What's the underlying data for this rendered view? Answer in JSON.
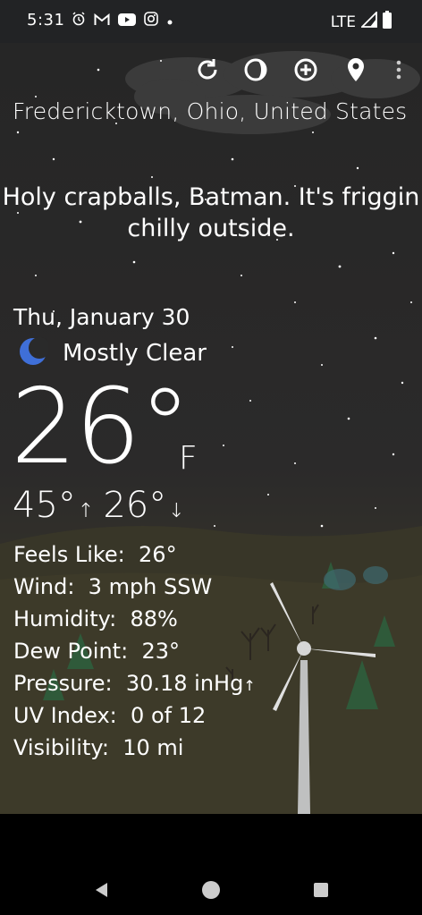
{
  "status": {
    "time": "5:31",
    "network": "LTE",
    "icons": [
      "alarm-icon",
      "gmail-icon",
      "youtube-icon",
      "instagram-icon",
      "dot-icon"
    ]
  },
  "toolbar": {
    "actions": [
      "refresh-icon",
      "theme-icon",
      "add-location-icon",
      "location-pin-icon",
      "more-icon"
    ]
  },
  "location": "Fredericktown, Ohio, United States",
  "tagline": "Holy crapballs, Batman. It's friggin chilly outside.",
  "date": "Thu, January 30",
  "condition": {
    "icon": "moon-icon",
    "text": "Mostly Clear"
  },
  "temperature": {
    "value": "26°",
    "unit": "F"
  },
  "hilo": {
    "high": "45°",
    "low": "26°"
  },
  "details": [
    {
      "label": "Feels Like:",
      "value": "26°"
    },
    {
      "label": "Wind:",
      "value": "3 mph SSW"
    },
    {
      "label": "Humidity:",
      "value": "88%"
    },
    {
      "label": "Dew Point:",
      "value": "23°"
    },
    {
      "label": "Pressure:",
      "value": "30.18 inHg"
    },
    {
      "label": "UV Index:",
      "value": "0 of 12"
    },
    {
      "label": "Visibility:",
      "value": "10 mi"
    }
  ],
  "colors": {
    "moon": "#3f6fd8",
    "background": "#262626",
    "ground": "#3b3827"
  },
  "nav": [
    "back-icon",
    "home-icon",
    "recents-icon"
  ]
}
